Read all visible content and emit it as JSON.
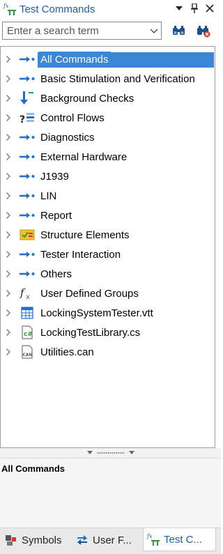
{
  "window": {
    "title": "Test Commands",
    "controls": [
      "dropdown",
      "pin",
      "close"
    ]
  },
  "search": {
    "placeholder": "Enter a search term",
    "value": ""
  },
  "tree": {
    "items": [
      {
        "label": "All Commands",
        "icon": "blue-arrow-icon",
        "selected": true
      },
      {
        "label": "Basic Stimulation and Verification",
        "icon": "blue-arrow-icon"
      },
      {
        "label": "Background Checks",
        "icon": "background-check-icon"
      },
      {
        "label": "Control Flows",
        "icon": "control-flow-icon"
      },
      {
        "label": "Diagnostics",
        "icon": "blue-arrow-icon"
      },
      {
        "label": "External Hardware",
        "icon": "blue-arrow-icon"
      },
      {
        "label": "J1939",
        "icon": "blue-arrow-icon"
      },
      {
        "label": "LIN",
        "icon": "blue-arrow-icon"
      },
      {
        "label": "Report",
        "icon": "blue-arrow-icon"
      },
      {
        "label": "Structure Elements",
        "icon": "structure-elements-icon"
      },
      {
        "label": "Tester Interaction",
        "icon": "blue-arrow-icon"
      },
      {
        "label": "Others",
        "icon": "blue-arrow-icon"
      },
      {
        "label": "User Defined Groups",
        "icon": "function-fx-icon"
      },
      {
        "label": "LockingSystemTester.vtt",
        "icon": "vtt-table-icon"
      },
      {
        "label": "LockingTestLibrary.cs",
        "icon": "csharp-file-icon"
      },
      {
        "label": "Utilities.can",
        "icon": "can-file-icon"
      }
    ]
  },
  "description": {
    "title": "All Commands"
  },
  "tabs": [
    {
      "label": "Symbols",
      "icon": "symbols-icon"
    },
    {
      "label": "User F...",
      "icon": "swap-arrows-icon"
    },
    {
      "label": "Test C...",
      "icon": "test-commands-icon",
      "active": true
    }
  ],
  "colors": {
    "accent": "#1a5fb4",
    "selection": "#3b86d6",
    "arrow_blue": "#1f6fd1"
  }
}
